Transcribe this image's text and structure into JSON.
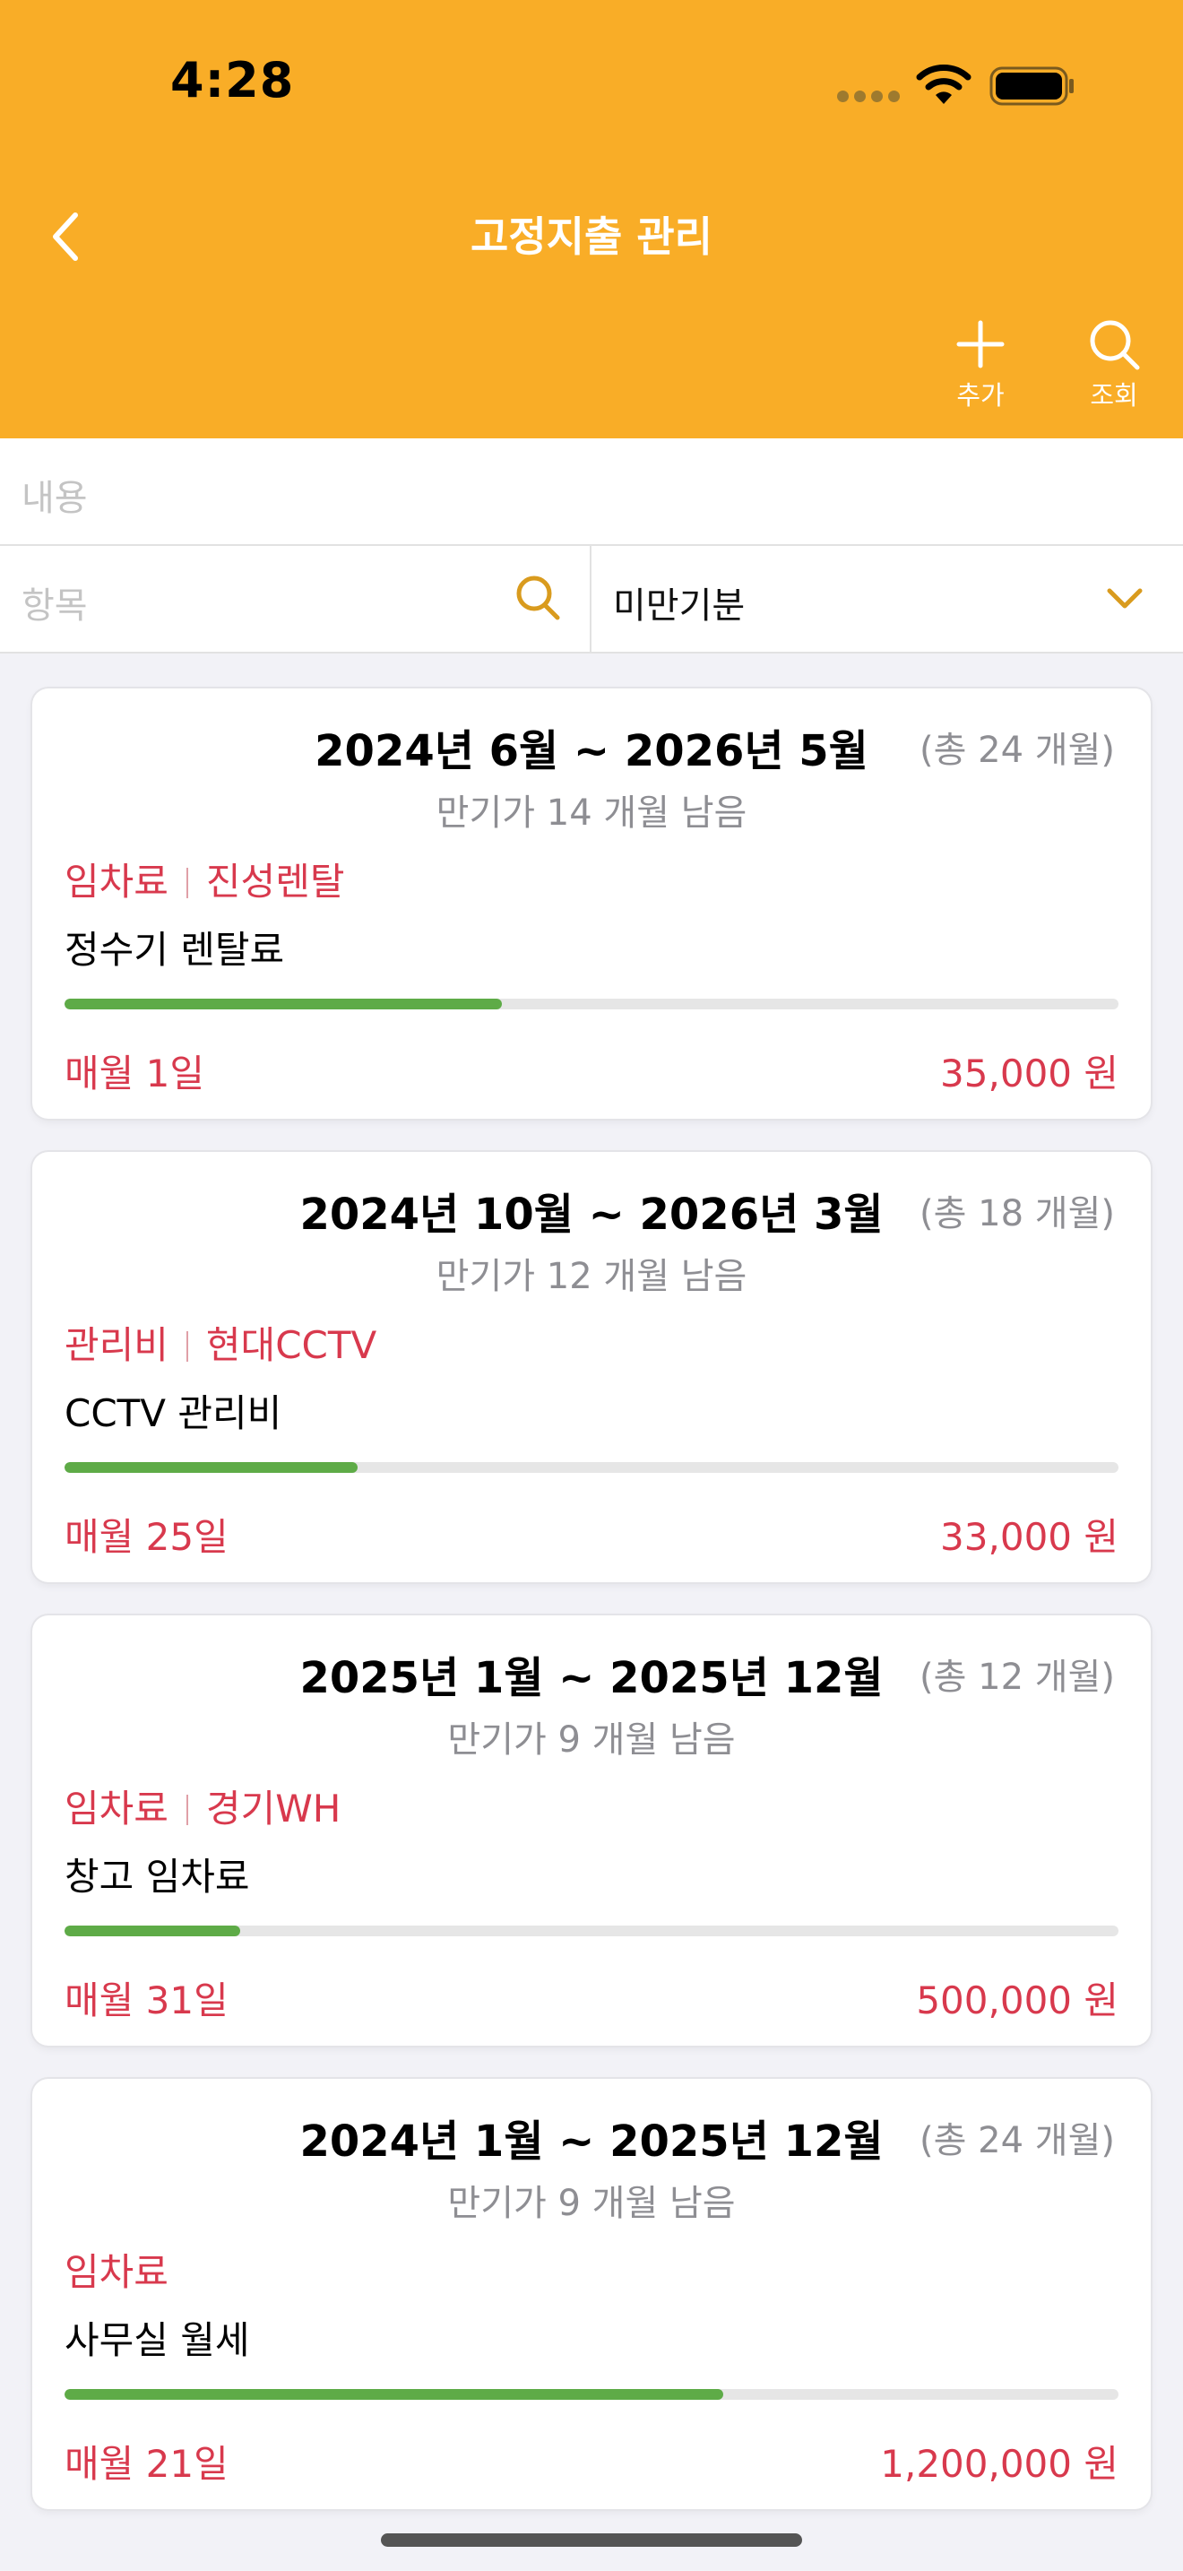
{
  "status_bar": {
    "time": "4:28"
  },
  "nav": {
    "title": "고정지출 관리",
    "add_label": "추가",
    "search_label": "조회"
  },
  "filters": {
    "content_placeholder": "내용",
    "item_placeholder": "항목",
    "period_selected": "미만기분"
  },
  "colors": {
    "header": "#f9ad27",
    "accent_red": "#d8394d",
    "progress": "#5eab47",
    "search_icon": "#d99b1e"
  },
  "cards": [
    {
      "period": "2024년 6월 ~ 2026년 5월",
      "total": "(총 24 개월)",
      "remaining": "만기가 14 개월 남음",
      "category": "임차료",
      "vendor": "진성렌탈",
      "description": "정수기 렌탈료",
      "progress": 0.415,
      "pay_day": "매월 1일",
      "amount": "35,000 원"
    },
    {
      "period": "2024년 10월 ~ 2026년 3월",
      "total": "(총 18 개월)",
      "remaining": "만기가 12 개월 남음",
      "category": "관리비",
      "vendor": "현대CCTV",
      "description": "CCTV 관리비",
      "progress": 0.278,
      "pay_day": "매월 25일",
      "amount": "33,000 원"
    },
    {
      "period": "2025년 1월 ~ 2025년 12월",
      "total": "(총 12 개월)",
      "remaining": "만기가 9 개월 남음",
      "category": "임차료",
      "vendor": "경기WH",
      "description": "창고 임차료",
      "progress": 0.167,
      "pay_day": "매월 31일",
      "amount": "500,000 원"
    },
    {
      "period": "2024년 1월 ~ 2025년 12월",
      "total": "(총 24 개월)",
      "remaining": "만기가 9 개월 남음",
      "category": "임차료",
      "vendor": "",
      "description": "사무실 월세",
      "progress": 0.625,
      "pay_day": "매월 21일",
      "amount": "1,200,000 원"
    }
  ]
}
